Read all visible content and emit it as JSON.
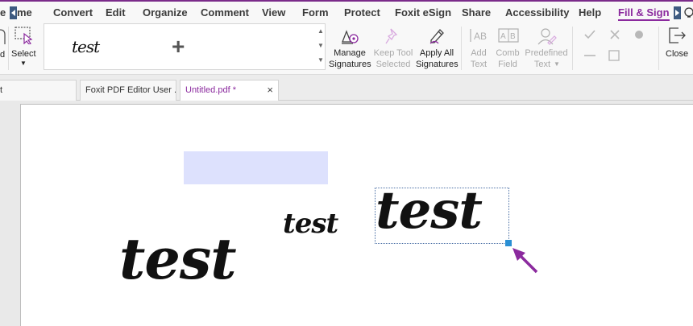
{
  "menu": {
    "items": [
      "me",
      "Convert",
      "Edit",
      "Organize",
      "Comment",
      "View",
      "Form",
      "Protect",
      "Foxit eSign",
      "Share",
      "Accessibility",
      "Help",
      "Fill & Sign"
    ],
    "cut_left": "e",
    "active": "Fill & Sign",
    "accent_color": "#8b2a9e"
  },
  "ribbon": {
    "cut_label": "d",
    "select_label": "Select",
    "gallery": {
      "signature_text": "test",
      "add_symbol": "+"
    },
    "manage": [
      "Manage",
      "Signatures"
    ],
    "keep_tool": [
      "Keep Tool",
      "Selected"
    ],
    "apply_all": [
      "Apply All",
      "Signatures"
    ],
    "add_text": [
      "Add",
      "Text"
    ],
    "comb_field": [
      "Comb",
      "Field"
    ],
    "predefined": [
      "Predefined",
      "Text"
    ],
    "close_label": "Close",
    "icons": [
      "manage-signatures-icon",
      "keep-tool-pin-icon",
      "apply-all-pen-icon",
      "add-text-icon",
      "comb-field-icon",
      "predefined-text-icon",
      "checkmark-icon",
      "cross-icon",
      "dot-icon",
      "line-icon",
      "box-icon",
      "close-doc-icon"
    ]
  },
  "tabs": {
    "cut_label": "t",
    "items": [
      {
        "label": "Foxit PDF Editor User ..."
      },
      {
        "label": "Untitled.pdf *"
      }
    ],
    "close_symbol": "×"
  },
  "document": {
    "signatures": [
      "test",
      "test",
      "test"
    ],
    "highlight_color": "#dde1fd",
    "arrow_color": "#8b2a9e"
  }
}
